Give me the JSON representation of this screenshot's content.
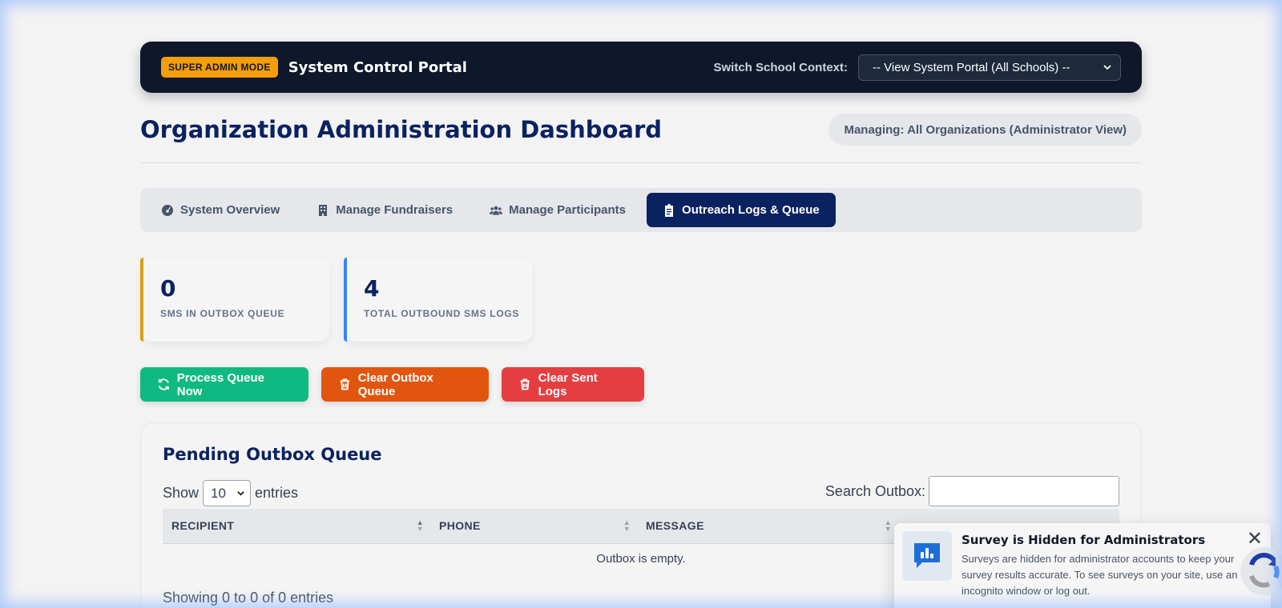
{
  "topbar": {
    "badge": "SUPER ADMIN MODE",
    "title": "System Control Portal",
    "context_label": "Switch School Context:",
    "context_value": "-- View System Portal (All Schools) --"
  },
  "header": {
    "title": "Organization Administration Dashboard",
    "managing": "Managing: All Organizations (Administrator View)"
  },
  "tabs": [
    {
      "label": "System Overview",
      "icon": "dashboard-gauge-icon"
    },
    {
      "label": "Manage Fundraisers",
      "icon": "building-icon"
    },
    {
      "label": "Manage Participants",
      "icon": "users-icon"
    },
    {
      "label": "Outreach Logs & Queue",
      "icon": "clipboard-icon",
      "active": true
    }
  ],
  "stats": [
    {
      "value": "0",
      "label": "SMS IN OUTBOX QUEUE",
      "accent": "#d4a017"
    },
    {
      "value": "4",
      "label": "TOTAL OUTBOUND SMS LOGS",
      "accent": "#3b82f6"
    }
  ],
  "actions": {
    "process": "Process Queue Now",
    "clear_outbox": "Clear Outbox Queue",
    "clear_logs": "Clear Sent Logs"
  },
  "outbox": {
    "title": "Pending Outbox Queue",
    "show_label": "Show",
    "entries_value": "10",
    "entries_label": "entries",
    "search_label": "Search Outbox:",
    "columns": [
      "RECIPIENT",
      "PHONE",
      "MESSAGE"
    ],
    "empty": "Outbox is empty.",
    "info": "Showing 0 to 0 of 0 entries"
  },
  "toast": {
    "title": "Survey is Hidden for Administrators",
    "body": "Surveys are hidden for administrator accounts to keep your survey results accurate. To see surveys on your site, use an incognito window or log out."
  },
  "colors": {
    "navy": "#0b2260",
    "topbar": "#0f172a",
    "badge": "#f59e0b",
    "green": "#10b981",
    "orange": "#e2550e",
    "red": "#e53e41"
  }
}
